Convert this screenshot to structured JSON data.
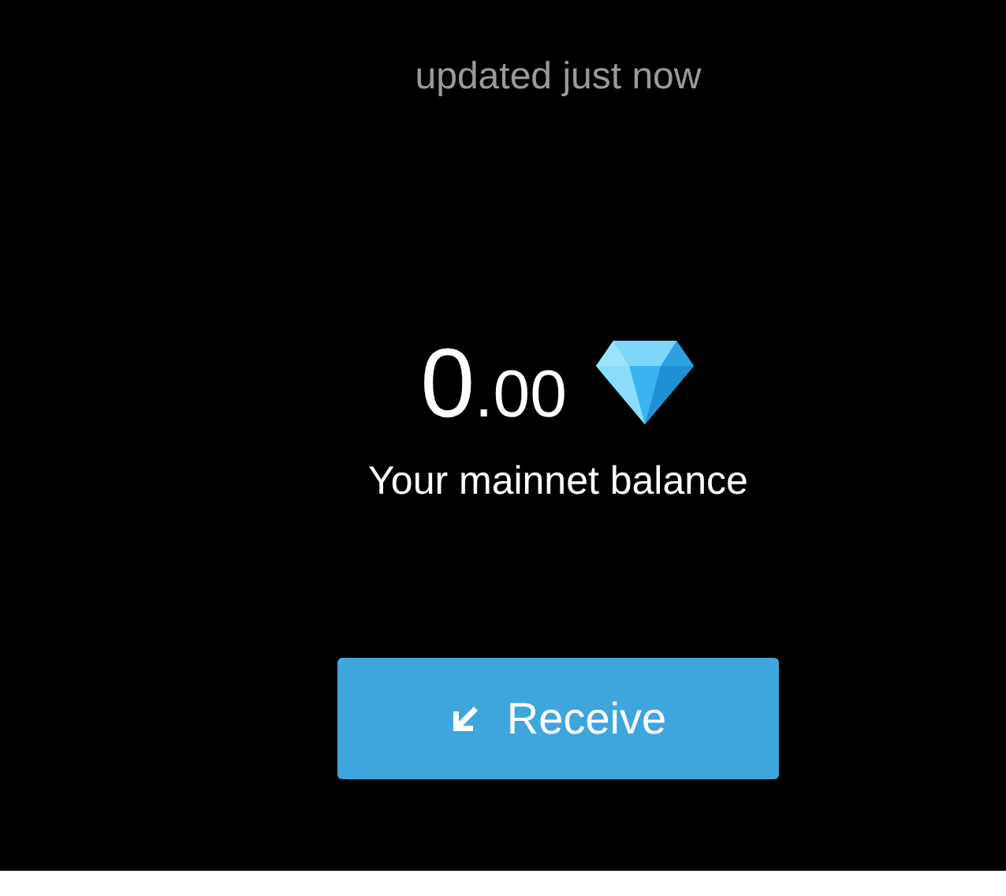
{
  "status": "updated just now",
  "balance": {
    "whole": "0",
    "fraction": ".00"
  },
  "balance_label": "Your mainnet balance",
  "buttons": [
    {
      "kind": "receive",
      "label": "Receive"
    }
  ]
}
